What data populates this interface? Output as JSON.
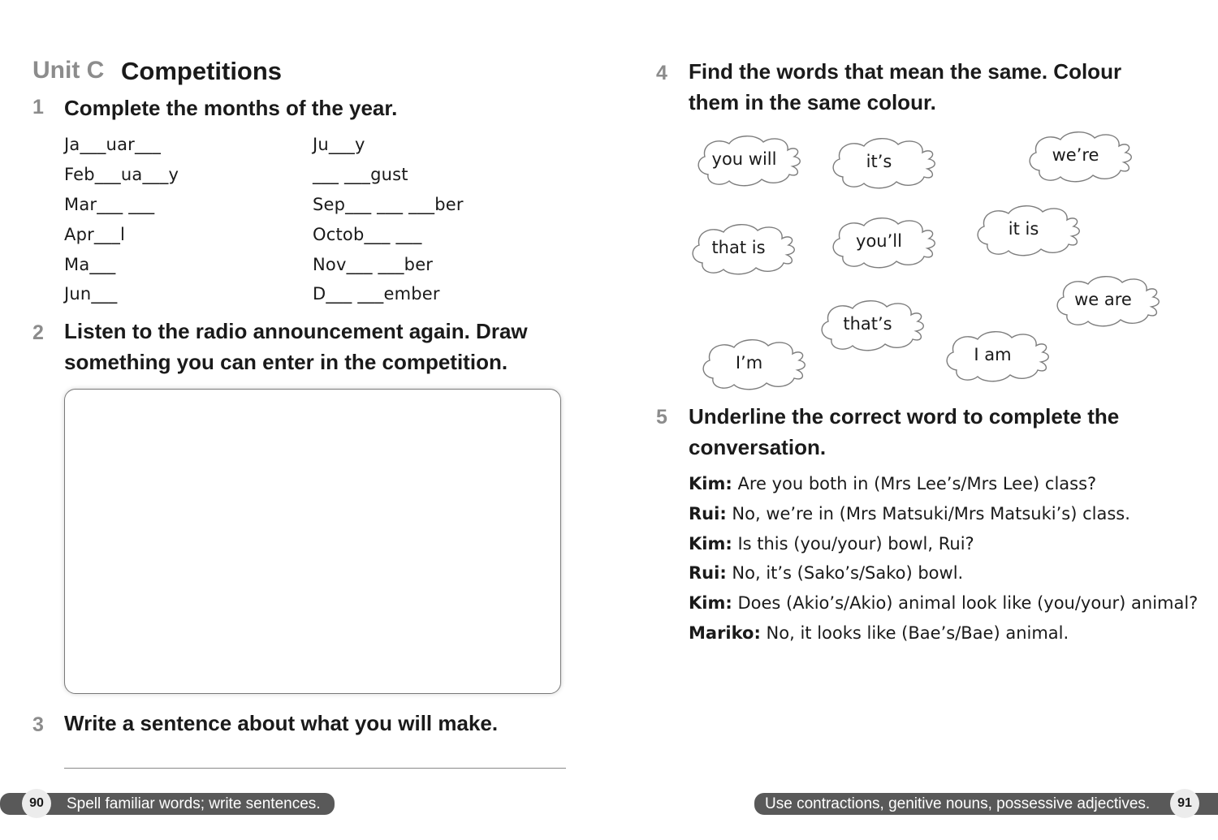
{
  "left_page": {
    "unit_label": "Unit C",
    "unit_title": "Competitions",
    "q1": {
      "number": "1",
      "text": "Complete the months of the year.",
      "months_col1": [
        "Ja___uar___",
        "Feb___ua___y",
        "Mar___ ___",
        "Apr___l",
        "Ma___",
        "Jun___"
      ],
      "months_col2": [
        "Ju___y",
        "___ ___gust",
        "Sep___ ___ ___ber",
        "Octob___ ___",
        "Nov___ ___ber",
        "D___ ___ember"
      ]
    },
    "q2": {
      "number": "2",
      "text_line1": "Listen to the radio announcement again. Draw",
      "text_line2": "something you can enter in the competition."
    },
    "q3": {
      "number": "3",
      "text": "Write a sentence about what you will make."
    },
    "footer": {
      "page_number": "90",
      "text": "Spell familiar words; write sentences."
    }
  },
  "right_page": {
    "q4": {
      "number": "4",
      "text_line1": "Find the words that mean the same. Colour",
      "text_line2": "them in the same colour.",
      "clouds": [
        "you will",
        "it’s",
        "we’re",
        "that is",
        "you’ll",
        "it is",
        "we are",
        "that’s",
        "I’m",
        "I am"
      ]
    },
    "q5": {
      "number": "5",
      "text_line1": "Underline the correct word to complete the",
      "text_line2": "conversation.",
      "dialogue": [
        {
          "speaker": "Kim:",
          "line": "Are you both in (Mrs Lee’s/Mrs Lee) class?"
        },
        {
          "speaker": "Rui:",
          "line": "No, we’re in (Mrs Matsuki/Mrs Matsuki’s) class."
        },
        {
          "speaker": "Kim:",
          "line": "Is this (you/your) bowl, Rui?"
        },
        {
          "speaker": "Rui:",
          "line": "No, it’s (Sako’s/Sako) bowl."
        },
        {
          "speaker": "Kim:",
          "line": "Does (Akio’s/Akio) animal look like (you/your) animal?"
        },
        {
          "speaker": "Mariko:",
          "line": "No, it looks like (Bae’s/Bae) animal."
        }
      ]
    },
    "footer": {
      "page_number": "91",
      "text": "Use contractions, genitive nouns, possessive adjectives."
    }
  }
}
